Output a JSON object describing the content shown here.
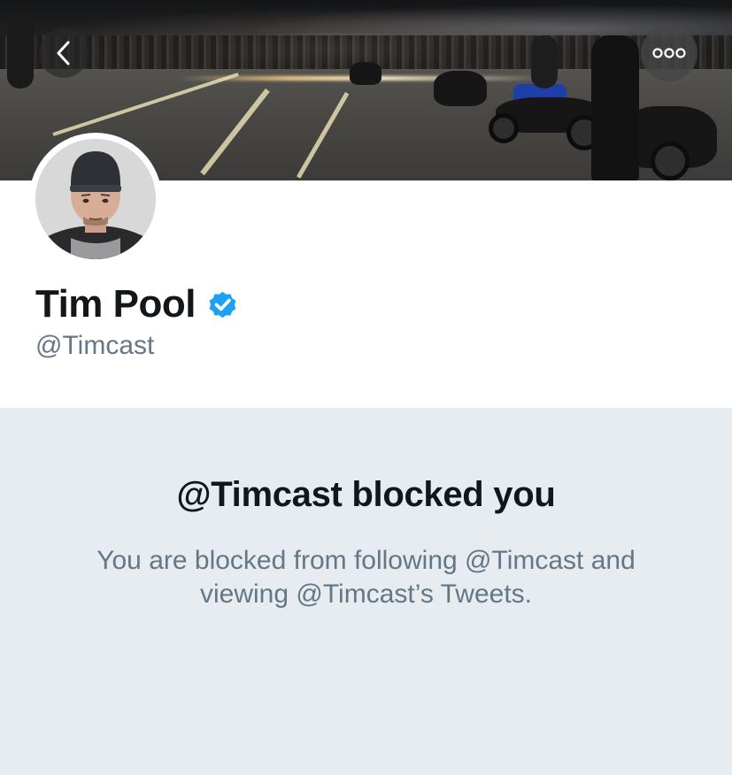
{
  "header": {
    "back_icon": "chevron-left-icon",
    "more_icon": "more-horizontal-icon"
  },
  "profile": {
    "display_name": "Tim Pool",
    "verified_icon": "verified-badge-icon",
    "handle": "@Timcast"
  },
  "blocked": {
    "title": "@Timcast blocked you",
    "message": "You are blocked from following @Timcast and viewing @Timcast’s Tweets."
  },
  "colors": {
    "accent": "#1da1f2",
    "text_primary": "#14171a",
    "text_secondary": "#657786",
    "panel_background": "#e6ecf0"
  }
}
